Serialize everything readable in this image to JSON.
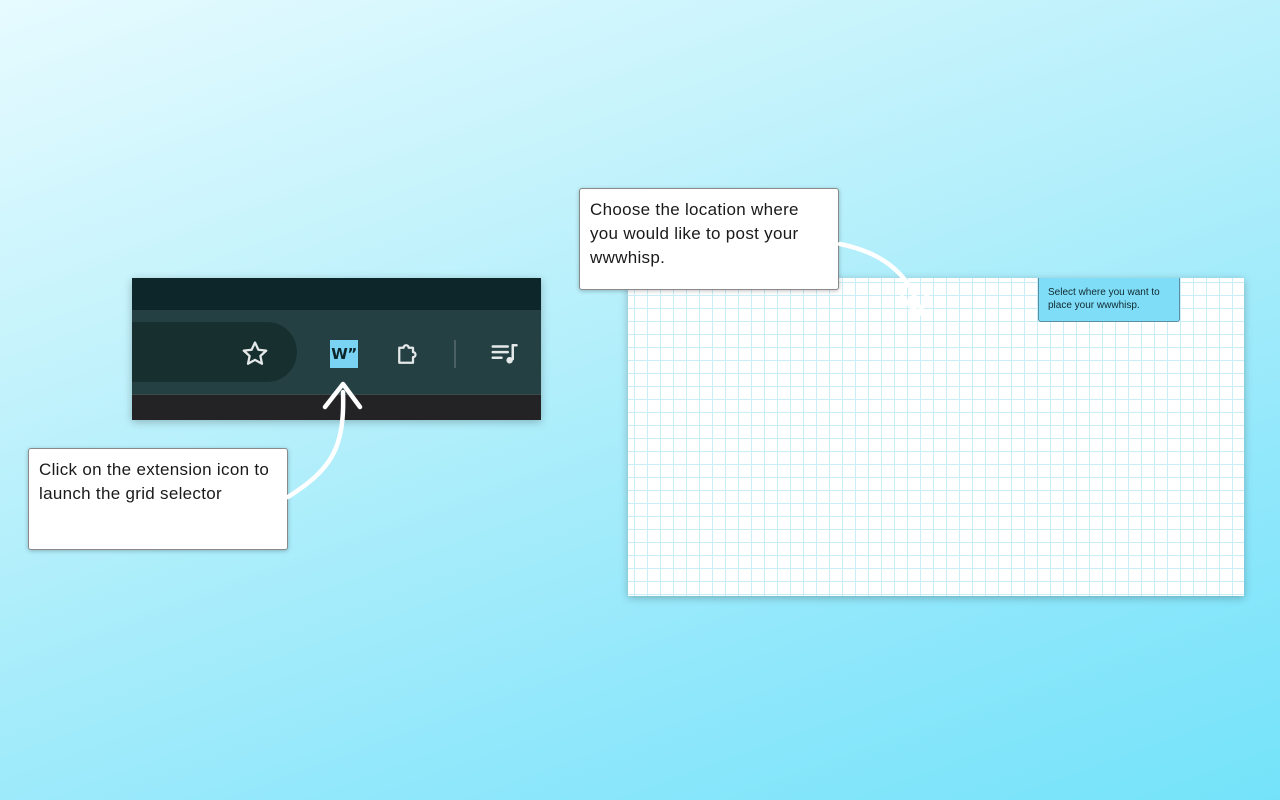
{
  "toolbar": {
    "star_icon": "star-icon",
    "extension_icon": {
      "name": "wwwhisp-extension-icon",
      "label": "W”",
      "color": "#7ad3f3"
    },
    "puzzle_icon": "puzzle-extensions-icon",
    "playlist_icon": "media-playlist-icon"
  },
  "callouts": {
    "step1": "Click on the extension icon to launch the grid selector",
    "step2": "Choose the location where you would like to post your wwwhisp."
  },
  "grid_panel": {
    "tooltip": "Select where you want to place your wwwhisp.",
    "line_color": "#c9eef7",
    "tooltip_color": "#7fddf8"
  },
  "colors": {
    "toolbar_dark": "#0d2629",
    "toolbar_bar": "#244043",
    "background_top": "#e6fbff",
    "background_bottom": "#74e3fa"
  }
}
